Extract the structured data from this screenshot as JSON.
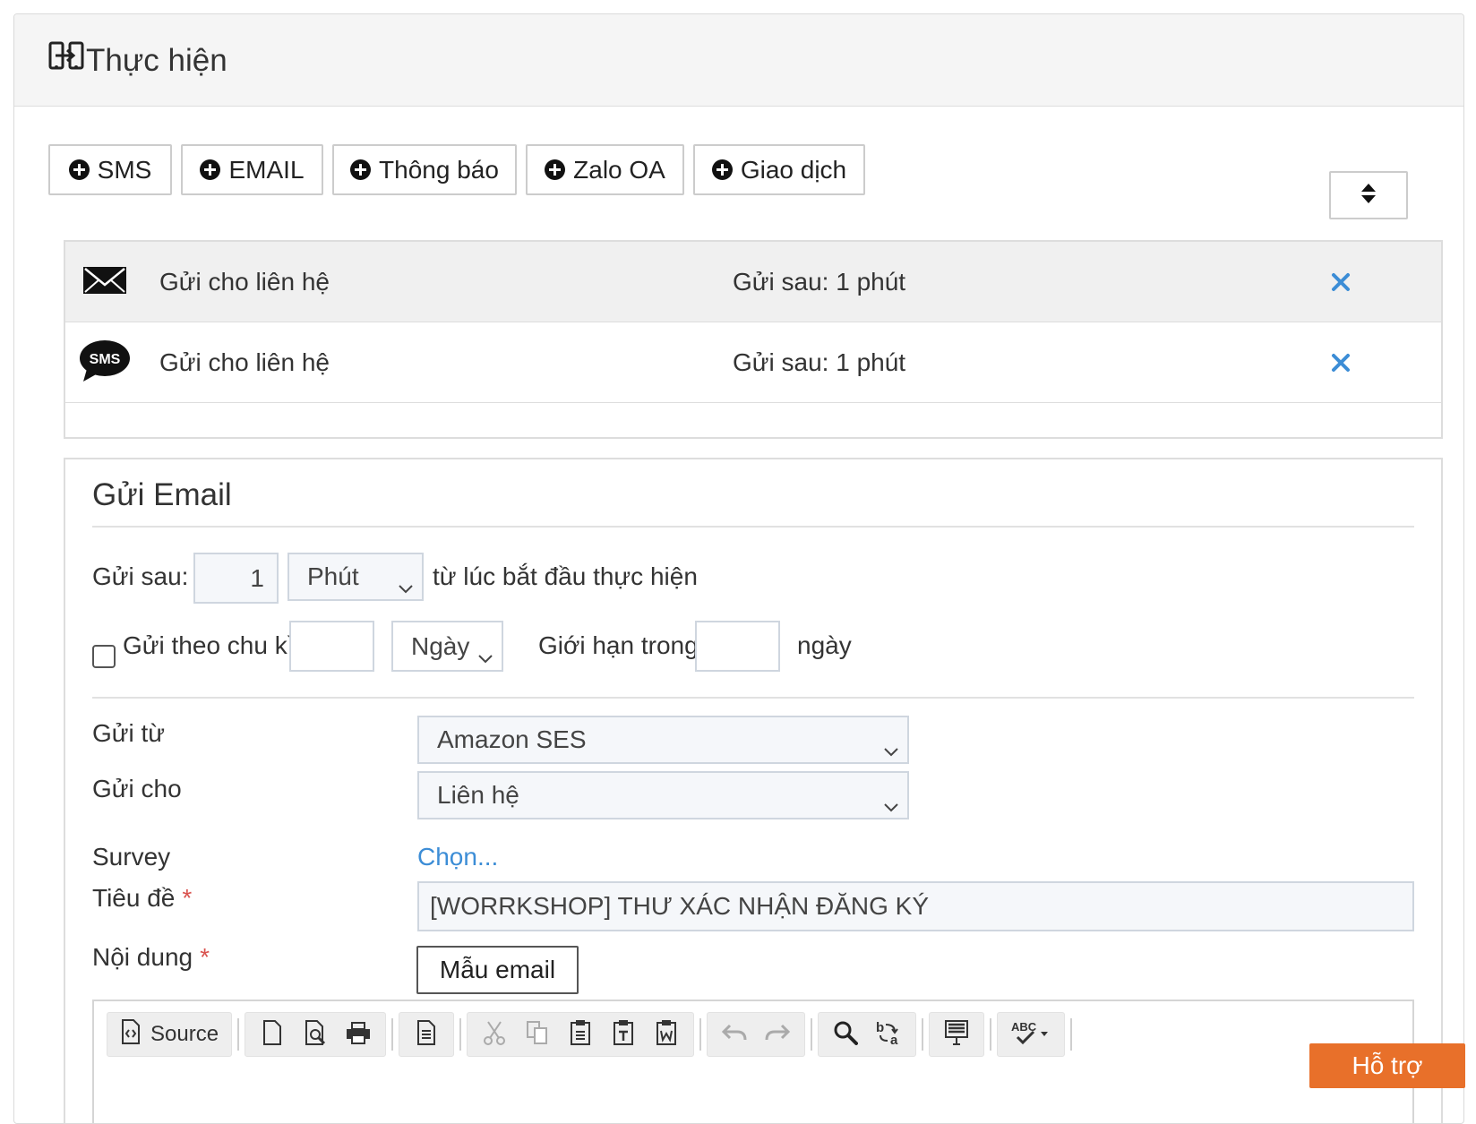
{
  "header": {
    "title": "Thực hiện",
    "icon": "transfer-icon"
  },
  "add_buttons": [
    "SMS",
    "EMAIL",
    "Thông báo",
    "Zalo OA",
    "Giao dịch"
  ],
  "actions": [
    {
      "icon": "envelope-icon",
      "label": "Gửi cho liên hệ",
      "delay": "Gửi sau: 1 phút"
    },
    {
      "icon": "sms-bubble-icon",
      "label": "Gửi cho liên hệ",
      "delay": "Gửi sau: 1 phút"
    }
  ],
  "email_form": {
    "title": "Gửi Email",
    "send_after_label": "Gửi sau:",
    "send_after_value": "1",
    "send_after_unit": "Phút",
    "send_after_suffix": "từ lúc bắt đầu thực hiện",
    "periodic_label": "Gửi theo chu kì",
    "periodic_value": "",
    "periodic_unit": "Ngày",
    "limit_label": "Giới hạn trong",
    "limit_value": "",
    "limit_suffix": "ngày",
    "from_label": "Gửi từ",
    "from_value": "Amazon SES",
    "to_label": "Gửi cho",
    "to_value": "Liên hệ",
    "survey_label": "Survey",
    "survey_link": "Chọn...",
    "subject_label": "Tiêu đề",
    "subject_value": "[WORRKSHOP] THƯ XÁC NHẬN ĐĂNG KÝ",
    "content_label": "Nội dung",
    "required_mark": "*",
    "template_button": "Mẫu email"
  },
  "editor_toolbar": {
    "source_label": "Source",
    "tools": [
      "source-icon",
      "new-page-icon",
      "preview-icon",
      "print-icon",
      "templates-icon",
      "cut-icon",
      "copy-icon",
      "paste-icon",
      "paste-text-icon",
      "paste-word-icon",
      "undo-icon",
      "redo-icon",
      "find-icon",
      "replace-icon",
      "select-all-icon",
      "spellcheck-icon"
    ]
  },
  "support_button": "Hỗ trợ",
  "colors": {
    "accent_link": "#3c8dd6",
    "remove_x": "#3c8dd6",
    "support": "#e8702a",
    "required": "#d9534f"
  }
}
